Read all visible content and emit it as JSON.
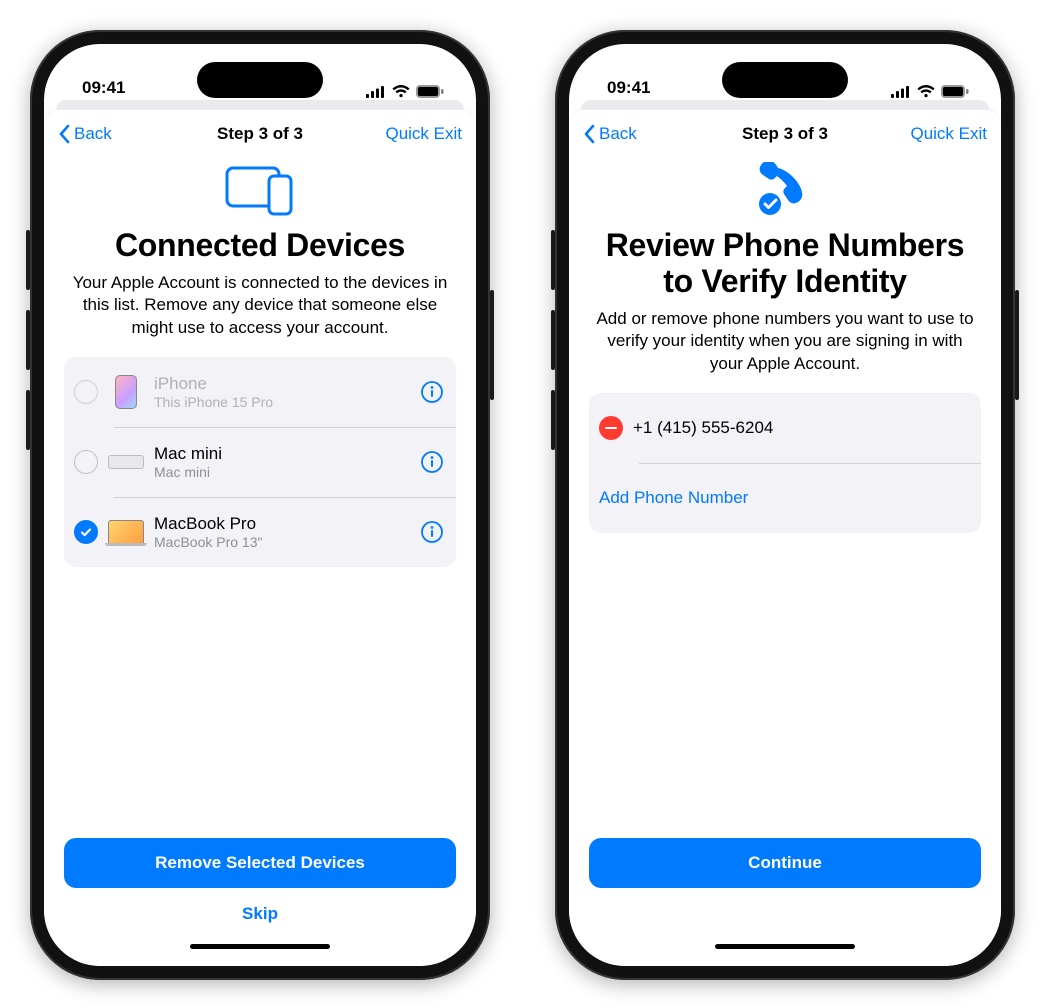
{
  "status_time": "09:41",
  "nav": {
    "back_label": "Back",
    "step_label": "Step 3 of 3",
    "quick_exit_label": "Quick Exit"
  },
  "screen_left": {
    "title": "Connected Devices",
    "description": "Your Apple Account is connected to the devices in this list. Remove any device that someone else might use to access your account.",
    "devices": [
      {
        "name": "iPhone",
        "subtitle": "This iPhone 15 Pro",
        "selected": false,
        "disabled": true,
        "kind": "iphone"
      },
      {
        "name": "Mac mini",
        "subtitle": "Mac mini",
        "selected": false,
        "disabled": false,
        "kind": "macmini"
      },
      {
        "name": "MacBook Pro",
        "subtitle": "MacBook Pro 13\"",
        "selected": true,
        "disabled": false,
        "kind": "mbp"
      }
    ],
    "primary_button": "Remove Selected Devices",
    "skip_label": "Skip"
  },
  "screen_right": {
    "title": "Review Phone Numbers to Verify Identity",
    "description": "Add or remove phone numbers you want to use to verify your identity when you are signing in with your Apple Account.",
    "phone_numbers": [
      "+1 (415) 555-6204"
    ],
    "add_label": "Add Phone Number",
    "primary_button": "Continue"
  }
}
